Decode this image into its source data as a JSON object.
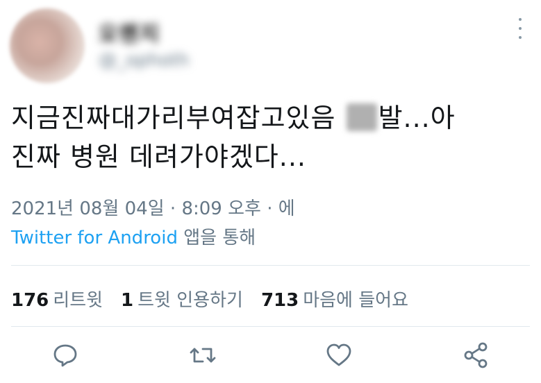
{
  "user": {
    "display_name": "오렌지",
    "handle": "@_ophoth"
  },
  "tweet": {
    "text_part1": "지금진짜대가리부여잡고있음 ",
    "text_part2": "발...아",
    "text_line2": "진짜 병원 데려가야겠다..."
  },
  "meta": {
    "date": "2021년 08월 04일",
    "sep1": " · ",
    "time": "8:09 오후",
    "sep2": " · ",
    "suffix": "에"
  },
  "source": {
    "app": "Twitter for Android",
    "suffix": " 앱을 통해"
  },
  "stats": {
    "retweets_count": "176",
    "retweets_label": "리트윗",
    "quotes_count": "1",
    "quotes_label": "트윗 인용하기",
    "likes_count": "713",
    "likes_label": "마음에 들어요"
  },
  "actions": {
    "icons": [
      "reply-icon",
      "retweet-icon",
      "like-icon",
      "share-icon"
    ]
  },
  "colors": {
    "accent": "#1da1f2",
    "secondary_text": "#657786",
    "icon": "#657786",
    "divider": "#e1e8ed"
  }
}
